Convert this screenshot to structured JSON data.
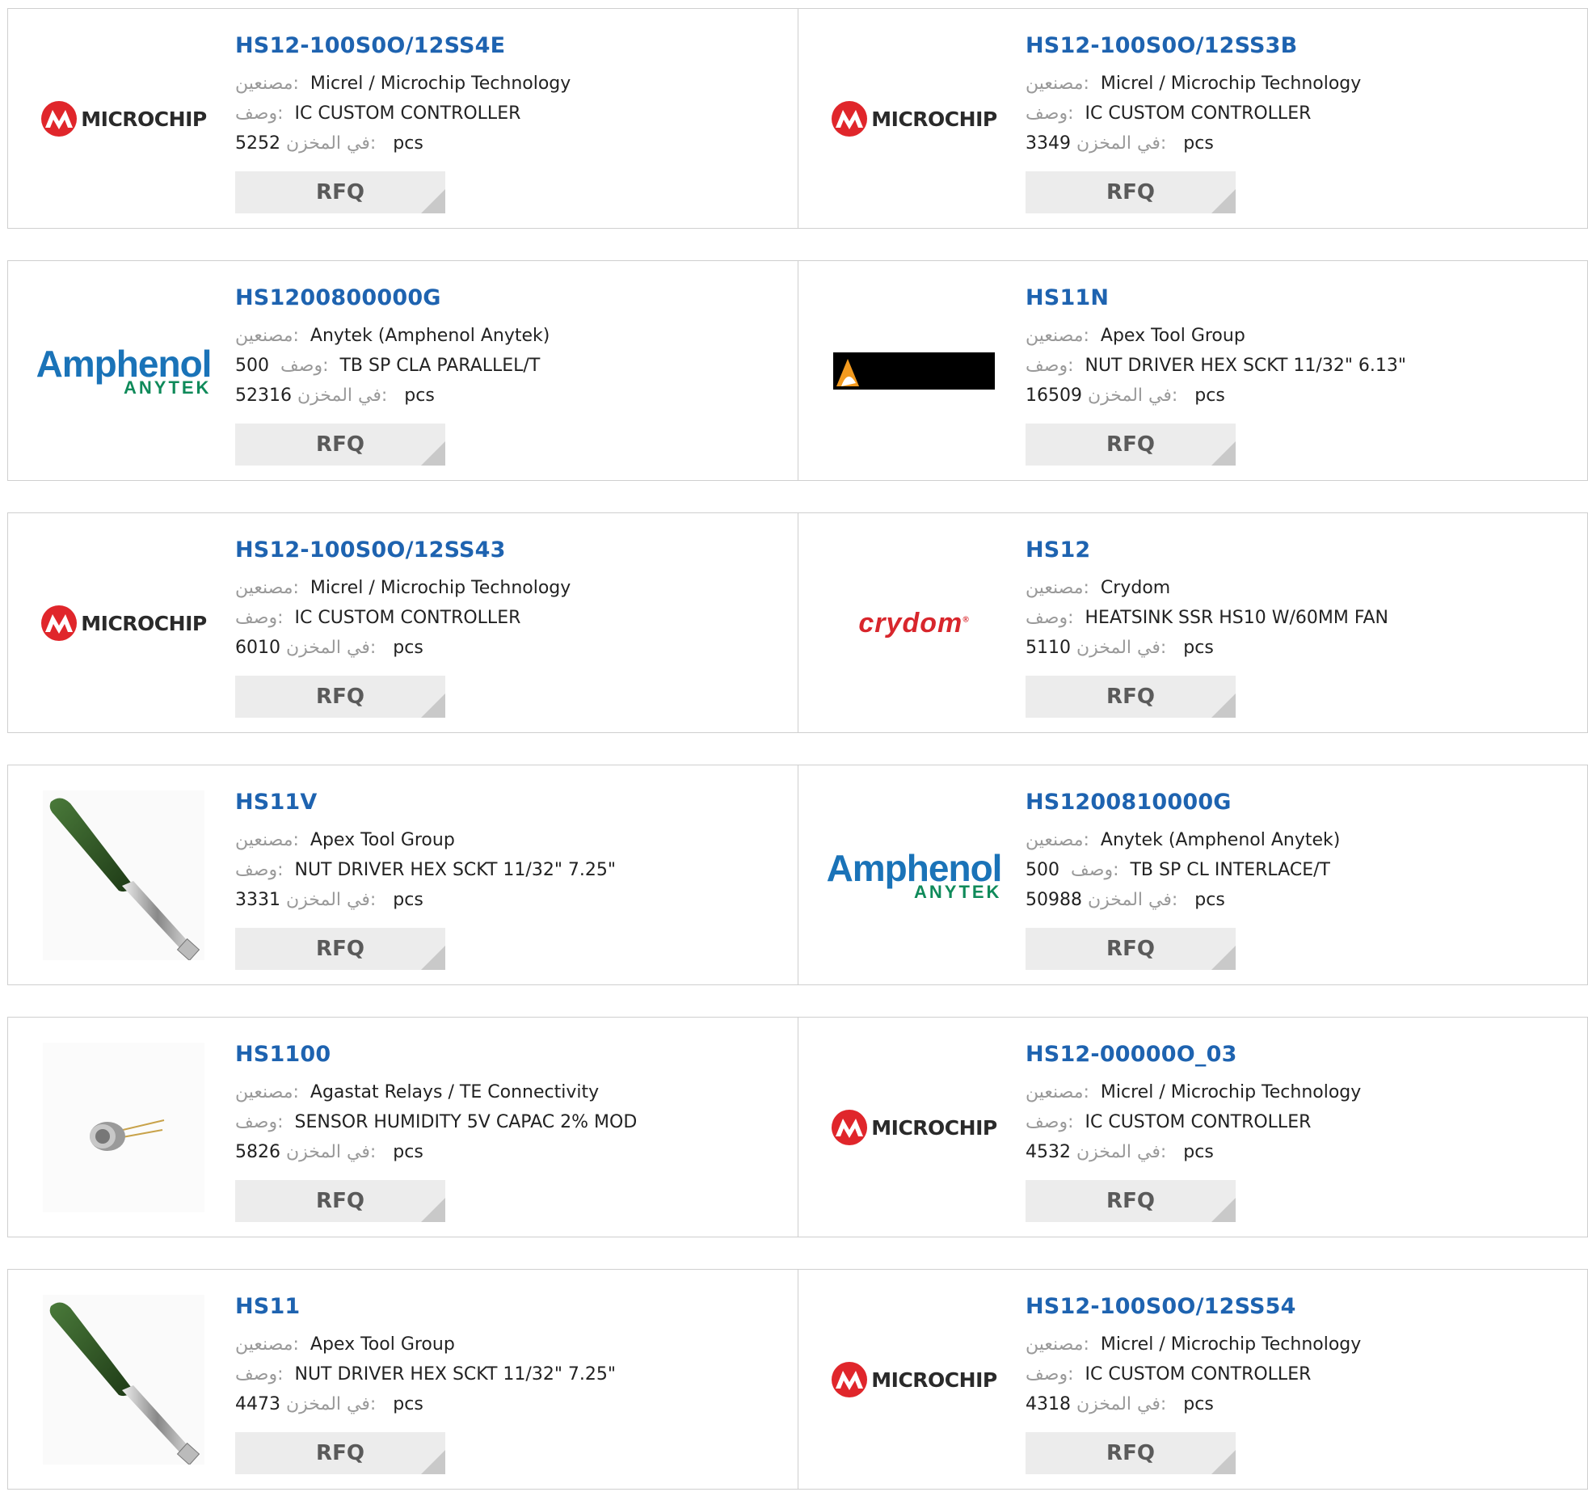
{
  "labels": {
    "manufacturer": "مصنعين:",
    "description": "وصف:",
    "stock": "في المخزن:",
    "unit": "pcs",
    "rfq": "RFQ"
  },
  "products": [
    {
      "part": "HS12-100S0O/12SS4E",
      "brand": "microchip",
      "manufacturer": "Micrel / Microchip Technology",
      "desc": "IC CUSTOM CONTROLLER",
      "stock": "5252"
    },
    {
      "part": "HS12-100S0O/12SS3B",
      "brand": "microchip",
      "manufacturer": "Micrel / Microchip Technology",
      "desc": "IC CUSTOM CONTROLLER",
      "stock": "3349"
    },
    {
      "part": "HS1200800000G",
      "brand": "amphenol",
      "manufacturer": "Anytek (Amphenol Anytek)",
      "desc_prefix": "500",
      "desc": "TB SP CLA PARALLEL/T",
      "stock": "52316"
    },
    {
      "part": "HS11N",
      "brand": "apex",
      "manufacturer": "Apex Tool Group",
      "desc": "NUT DRIVER HEX SCKT 11/32\" 6.13\"",
      "stock": "16509"
    },
    {
      "part": "HS12-100S0O/12SS43",
      "brand": "microchip",
      "manufacturer": "Micrel / Microchip Technology",
      "desc": "IC CUSTOM CONTROLLER",
      "stock": "6010"
    },
    {
      "part": "HS12",
      "brand": "crydom",
      "manufacturer": "Crydom",
      "desc": "HEATSINK SSR HS10 W/60MM FAN",
      "stock": "5110"
    },
    {
      "part": "HS11V",
      "brand": "screwdriver",
      "manufacturer": "Apex Tool Group",
      "desc": "NUT DRIVER HEX SCKT 11/32\" 7.25\"",
      "stock": "3331"
    },
    {
      "part": "HS1200810000G",
      "brand": "amphenol",
      "manufacturer": "Anytek (Amphenol Anytek)",
      "desc_prefix": "500",
      "desc": "TB SP CL INTERLACE/T",
      "stock": "50988"
    },
    {
      "part": "HS1100",
      "brand": "sensor",
      "manufacturer": "Agastat Relays / TE Connectivity",
      "desc": "SENSOR HUMIDITY 5V CAPAC 2% MOD",
      "stock": "5826"
    },
    {
      "part": "HS12-00000O_03",
      "brand": "microchip",
      "manufacturer": "Micrel / Microchip Technology",
      "desc": "IC CUSTOM CONTROLLER",
      "stock": "4532"
    },
    {
      "part": "HS11",
      "brand": "screwdriver",
      "manufacturer": "Apex Tool Group",
      "desc": "NUT DRIVER HEX SCKT 11/32\" 7.25\"",
      "stock": "4473"
    },
    {
      "part": "HS12-100S0O/12SS54",
      "brand": "microchip",
      "manufacturer": "Micrel / Microchip Technology",
      "desc": "IC CUSTOM CONTROLLER",
      "stock": "4318"
    }
  ],
  "logo_text": {
    "microchip": "MICROCHIP",
    "amphenol_top": "Amphenol",
    "amphenol_bottom": "ANYTEK",
    "crydom": "crydom"
  },
  "colors": {
    "part_link": "#1e63b0",
    "label_gray": "#999999",
    "rfq_bg": "#ececec",
    "border": "#cfcfcf",
    "microchip_red": "#e0262b",
    "amphenol_blue": "#1a73b8",
    "anytek_green": "#0f8a5a",
    "crydom_red": "#d8262c"
  }
}
